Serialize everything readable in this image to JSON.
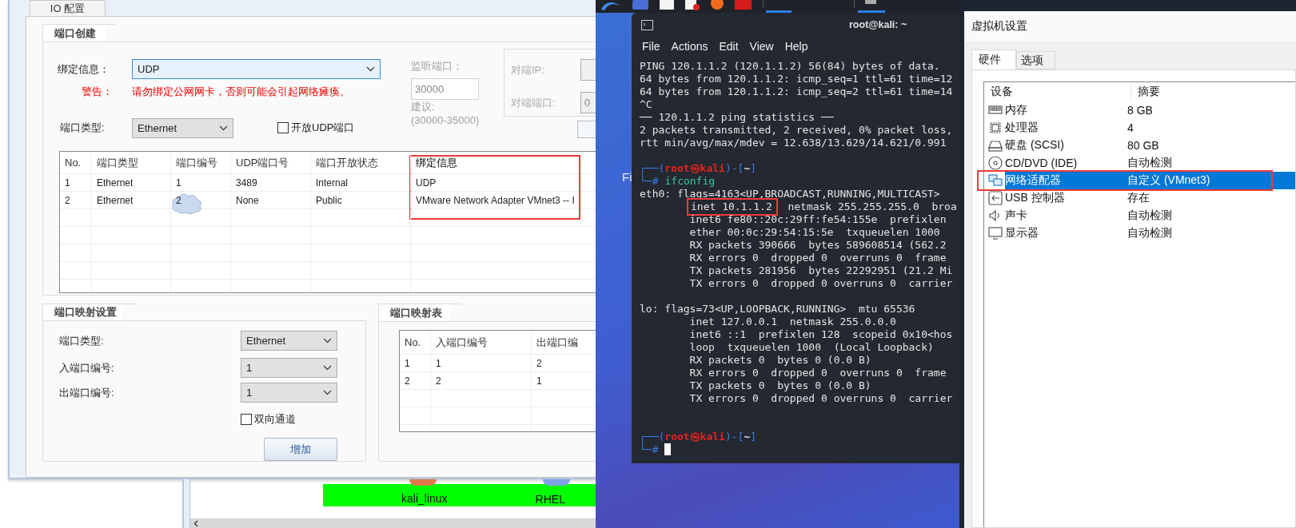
{
  "io_window": {
    "tab": "IO 配置",
    "port_create": {
      "title": "端口创建",
      "bind_label": "绑定信息：",
      "bind_value": "UDP",
      "warning_label": "警告：",
      "warning_text": "请勿绑定公网网卡，否则可能会引起网络瘫痪。",
      "listen_label": "监听端口：",
      "listen_value": "30000",
      "suggest_label": "建议:",
      "suggest_range": "(30000-35000)",
      "peer_ip_label": "对端IP:",
      "peer_port_label": "对端端口:",
      "peer_port_value": "0",
      "port_type_label": "端口类型:",
      "port_type_value": "Ethernet",
      "open_udp": {
        "label": "开放UDP端口",
        "checked": false
      },
      "table": {
        "columns": [
          "No.",
          "端口类型",
          "端口编号",
          "UDP端口号",
          "端口开放状态",
          "绑定信息"
        ],
        "rows": [
          [
            "1",
            "Ethernet",
            "1",
            "3489",
            "Internal",
            "UDP"
          ],
          [
            "2",
            "Ethernet",
            "2",
            "None",
            "Public",
            "VMware Network Adapter VMnet3 -- I"
          ]
        ]
      }
    },
    "mapping_settings": {
      "title": "端口映射设置",
      "fields": [
        {
          "label": "端口类型:",
          "value": "Ethernet"
        },
        {
          "label": "入端口编号:",
          "value": "1"
        },
        {
          "label": "出端口编号:",
          "value": "1"
        }
      ],
      "bidirectional": {
        "label": "双向通道",
        "checked": false
      },
      "add_button": "增加"
    },
    "mapping_table": {
      "title": "端口映射表",
      "columns": [
        "No.",
        "入端口编号",
        "出端口编"
      ],
      "rows": [
        [
          "1",
          "1",
          "2"
        ],
        [
          "2",
          "2",
          "1"
        ]
      ]
    }
  },
  "topology": {
    "nodes": [
      {
        "label": "kali_linux"
      },
      {
        "label": "RHEL"
      }
    ]
  },
  "desktop": {
    "icon_label": "Fi"
  },
  "terminal": {
    "title": "root@kali: ~",
    "menu": [
      "File",
      "Actions",
      "Edit",
      "View",
      "Help"
    ],
    "lines": [
      {
        "kind": "out",
        "text": "PING 120.1.1.2 (120.1.1.2) 56(84) bytes of data."
      },
      {
        "kind": "out",
        "text": "64 bytes from 120.1.1.2: icmp_seq=1 ttl=61 time=12"
      },
      {
        "kind": "out",
        "text": "64 bytes from 120.1.1.2: icmp_seq=2 ttl=61 time=14"
      },
      {
        "kind": "out",
        "text": "^C"
      },
      {
        "kind": "out",
        "text": "── 120.1.1.2 ping statistics ──"
      },
      {
        "kind": "out",
        "text": "2 packets transmitted, 2 received, 0% packet loss,"
      },
      {
        "kind": "out",
        "text": "rtt min/avg/max/mdev = 12.638/13.629/14.621/0.991"
      },
      {
        "kind": "blank"
      },
      {
        "kind": "prompt",
        "open": "┌──(",
        "user": "root㉿kali",
        "mid": ")-[",
        "dir": "~",
        "close": "]"
      },
      {
        "kind": "command",
        "mark": "└─#",
        "command": "ifconfig"
      },
      {
        "kind": "out",
        "text": "eth0: flags=4163<UP,BROADCAST,RUNNING,MULTICAST>"
      },
      {
        "kind": "marked",
        "mark": "inet 10.1.1.2",
        "rest": "  netmask 255.255.255.0  broa"
      },
      {
        "kind": "out",
        "text": "        inet6 fe80::20c:29ff:fe54:155e  prefixlen"
      },
      {
        "kind": "out",
        "text": "        ether 00:0c:29:54:15:5e  txqueuelen 1000"
      },
      {
        "kind": "out",
        "text": "        RX packets 390666  bytes 589608514 (562.2"
      },
      {
        "kind": "out",
        "text": "        RX errors 0  dropped 0  overruns 0  frame"
      },
      {
        "kind": "out",
        "text": "        TX packets 281956  bytes 22292951 (21.2 Mi"
      },
      {
        "kind": "out",
        "text": "        TX errors 0  dropped 0 overruns 0  carrier"
      },
      {
        "kind": "blank"
      },
      {
        "kind": "out",
        "text": "lo: flags=73<UP,LOOPBACK,RUNNING>  mtu 65536"
      },
      {
        "kind": "out",
        "text": "        inet 127.0.0.1  netmask 255.0.0.0"
      },
      {
        "kind": "out",
        "text": "        inet6 ::1  prefixlen 128  scopeid 0x10<hos"
      },
      {
        "kind": "out",
        "text": "        loop  txqueuelen 1000  (Local Loopback)"
      },
      {
        "kind": "out",
        "text": "        RX packets 0  bytes 0 (0.0 B)"
      },
      {
        "kind": "out",
        "text": "        RX errors 0  dropped 0  overruns 0  frame"
      },
      {
        "kind": "out",
        "text": "        TX packets 0  bytes 0 (0.0 B)"
      },
      {
        "kind": "out",
        "text": "        TX errors 0  dropped 0 overruns 0  carrier"
      },
      {
        "kind": "blank"
      },
      {
        "kind": "blank"
      },
      {
        "kind": "prompt",
        "open": "┌──(",
        "user": "root㉿kali",
        "mid": ")-[",
        "dir": "~",
        "close": "]"
      },
      {
        "kind": "command",
        "mark": "└─#",
        "cursor": true
      }
    ]
  },
  "vm_settings": {
    "title": "虚拟机设置",
    "tabs": [
      {
        "label": "硬件",
        "selected": true
      },
      {
        "label": "选项",
        "selected": false
      }
    ],
    "columns": [
      "设备",
      "摘要"
    ],
    "devices": [
      {
        "kind": "memory",
        "name": "内存",
        "summary": "8 GB",
        "selected": false
      },
      {
        "kind": "cpu",
        "name": "处理器",
        "summary": "4",
        "selected": false
      },
      {
        "kind": "disk",
        "name": "硬盘 (SCSI)",
        "summary": "80 GB",
        "selected": false
      },
      {
        "kind": "cd",
        "name": "CD/DVD (IDE)",
        "summary": "自动检测",
        "selected": false
      },
      {
        "kind": "network",
        "name": "网络适配器",
        "summary": "自定义 (VMnet3)",
        "selected": true
      },
      {
        "kind": "usb",
        "name": "USB 控制器",
        "summary": "存在",
        "selected": false
      },
      {
        "kind": "sound",
        "name": "声卡",
        "summary": "自动检测",
        "selected": false
      },
      {
        "kind": "display",
        "name": "显示器",
        "summary": "自动检测",
        "selected": false
      }
    ]
  }
}
